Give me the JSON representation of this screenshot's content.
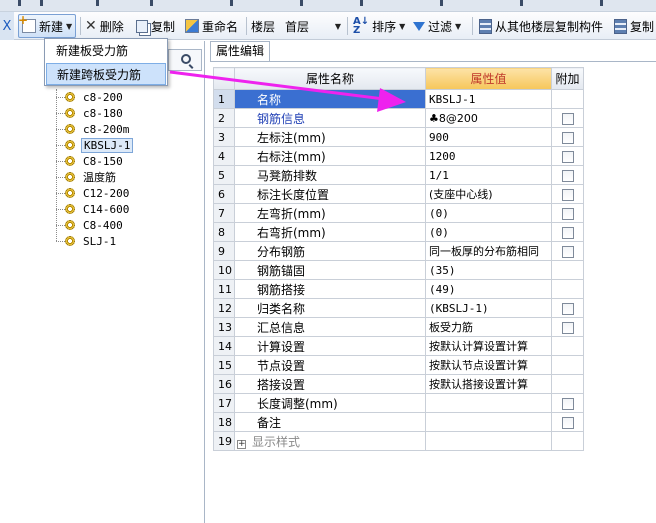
{
  "toolbar": {
    "close": "X",
    "new_label": "新建",
    "delete_label": "删除",
    "copy_label": "复制",
    "rename_label": "重命名",
    "floor_label": "楼层",
    "floor_value": "首层",
    "sort_label": "排序",
    "filter_label": "过滤",
    "copy_from_floor_label": "从其他楼层复制构件",
    "copy2_label": "复制"
  },
  "menu": {
    "items": [
      "新建板受力筋",
      "新建跨板受力筋"
    ],
    "highlighted_index": 1
  },
  "tree": {
    "items": [
      {
        "label": "c8-200"
      },
      {
        "label": "c8-180"
      },
      {
        "label": "c8-200m"
      },
      {
        "label": "KBSLJ-1",
        "selected": true
      },
      {
        "label": "C8-150"
      },
      {
        "label": "温度筋"
      },
      {
        "label": "C12-200"
      },
      {
        "label": "C14-600"
      },
      {
        "label": "C8-400"
      },
      {
        "label": "SLJ-1"
      }
    ]
  },
  "properties": {
    "tab_label": "属性编辑",
    "headers": {
      "name": "属性名称",
      "value": "属性值",
      "extra": "附加"
    },
    "rows": [
      {
        "num": "1",
        "name": "名称",
        "value": "KBSLJ-1",
        "blue": true,
        "checkbox": false,
        "selected": true
      },
      {
        "num": "2",
        "name": "钢筋信息",
        "value": "♣8@200",
        "blue": true,
        "checkbox": true
      },
      {
        "num": "3",
        "name": "左标注(mm)",
        "value": "900",
        "checkbox": true
      },
      {
        "num": "4",
        "name": "右标注(mm)",
        "value": "1200",
        "checkbox": true
      },
      {
        "num": "5",
        "name": "马凳筋排数",
        "value": "1/1",
        "checkbox": true
      },
      {
        "num": "6",
        "name": "标注长度位置",
        "value": "(支座中心线)",
        "checkbox": true
      },
      {
        "num": "7",
        "name": "左弯折(mm)",
        "value": "(0)",
        "checkbox": true
      },
      {
        "num": "8",
        "name": "右弯折(mm)",
        "value": "(0)",
        "checkbox": true
      },
      {
        "num": "9",
        "name": "分布钢筋",
        "value": "同一板厚的分布筋相同",
        "checkbox": true
      },
      {
        "num": "10",
        "name": "钢筋锚固",
        "value": "(35)",
        "checkbox": false
      },
      {
        "num": "11",
        "name": "钢筋搭接",
        "value": "(49)",
        "checkbox": false
      },
      {
        "num": "12",
        "name": "归类名称",
        "value": "(KBSLJ-1)",
        "checkbox": true
      },
      {
        "num": "13",
        "name": "汇总信息",
        "value": "板受力筋",
        "checkbox": true
      },
      {
        "num": "14",
        "name": "计算设置",
        "value": "按默认计算设置计算",
        "checkbox": false
      },
      {
        "num": "15",
        "name": "节点设置",
        "value": "按默认节点设置计算",
        "checkbox": false
      },
      {
        "num": "16",
        "name": "搭接设置",
        "value": "按默认搭接设置计算",
        "checkbox": false
      },
      {
        "num": "17",
        "name": "长度调整(mm)",
        "value": "",
        "checkbox": true
      },
      {
        "num": "18",
        "name": "备注",
        "value": "",
        "checkbox": true
      },
      {
        "num": "19",
        "name": "显示样式",
        "value": "",
        "checkbox": false,
        "gray": true,
        "expand": true
      }
    ]
  },
  "colors": {
    "annotation_arrow": "#ee22ee",
    "selected_row": "#3a6fd1",
    "value_header": "#f6c65a"
  }
}
